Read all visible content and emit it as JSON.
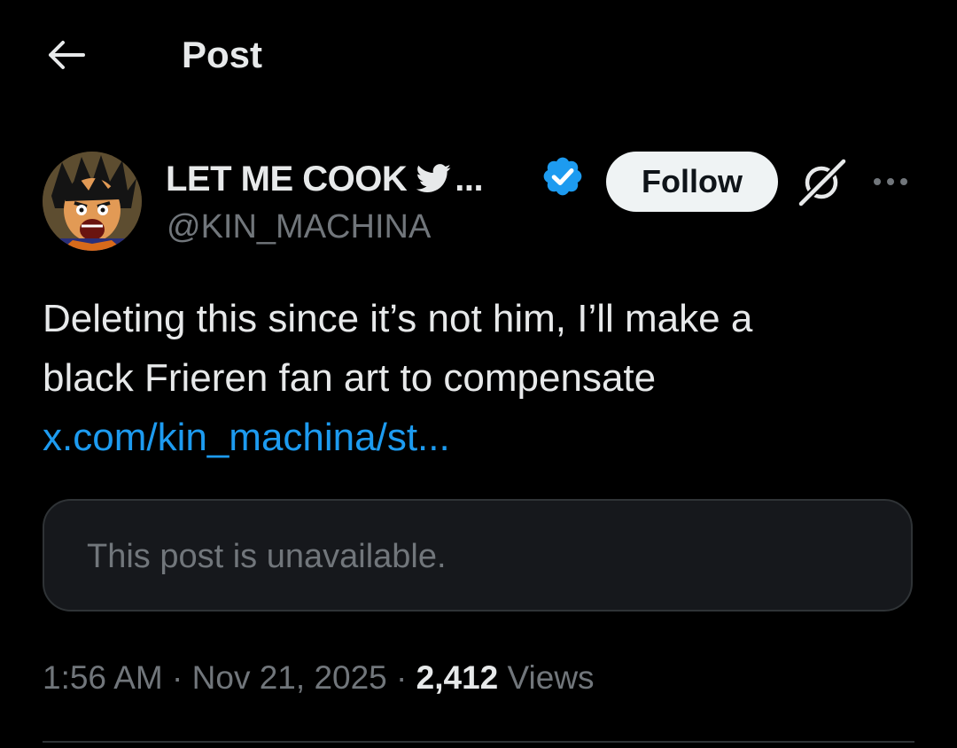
{
  "header": {
    "title": "Post"
  },
  "author": {
    "display_name": "LET ME COOK",
    "name_ellipsis": "...",
    "handle": "@KIN_MACHINA",
    "follow_label": "Follow"
  },
  "post": {
    "line1": "Deleting this since it’s not him, I’ll make a",
    "line2": "black Frieren fan art to compensate",
    "link": "x.com/kin_machina/st..."
  },
  "quoted": {
    "text": "This post is unavailable."
  },
  "meta": {
    "time": "1:56 AM",
    "separator": "·",
    "date": "Nov 21, 2025",
    "views_count": "2,412",
    "views_label": "Views"
  },
  "colors": {
    "background": "#000000",
    "text": "#e7e9ea",
    "secondary": "#71767b",
    "link": "#1d9bf0",
    "verified": "#1d9bf0",
    "follow_bg": "#eff3f4",
    "card_bg": "#16181c",
    "border": "#2f3336"
  },
  "icons": {
    "back": "arrow-left-icon",
    "name_emoji": "bird-icon",
    "verified": "verified-badge-icon",
    "grok": "grok-icon",
    "more": "more-horizontal-icon"
  }
}
